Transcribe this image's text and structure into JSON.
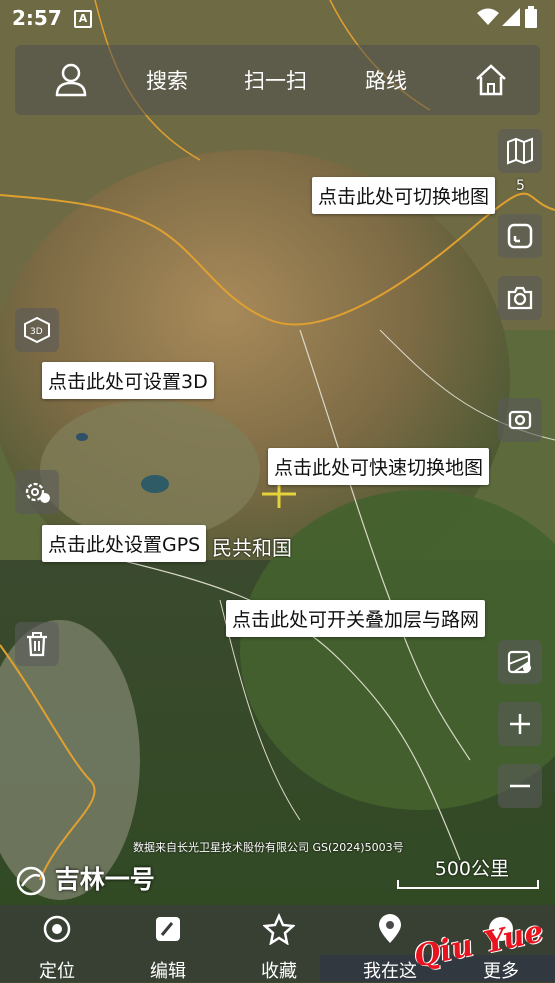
{
  "status": {
    "time": "2:57",
    "notif_badge": "A"
  },
  "topbar": {
    "search": "搜索",
    "scan": "扫一扫",
    "route": "路线"
  },
  "side_badge": "5",
  "tips": {
    "switch_map": "点击此处可切换地图",
    "set_3d": "点击此处可设置3D",
    "quick_switch": "点击此处可快速切换地图",
    "set_gps": "点击此处设置GPS",
    "overlay_toggle": "点击此处可开关叠加层与路网"
  },
  "map_label": "民共和国",
  "attribution": "数据来自长光卫星技术股份有限公司 GS(2024)5003号",
  "logo_text": "吉林一号",
  "scale_label": "500公里",
  "bottom_nav": {
    "locate": "定位",
    "edit": "编辑",
    "favorites": "收藏",
    "here": "我在这",
    "more": "更多"
  },
  "watermark": {
    "word1": "Qiu",
    "word2": "Yue"
  }
}
